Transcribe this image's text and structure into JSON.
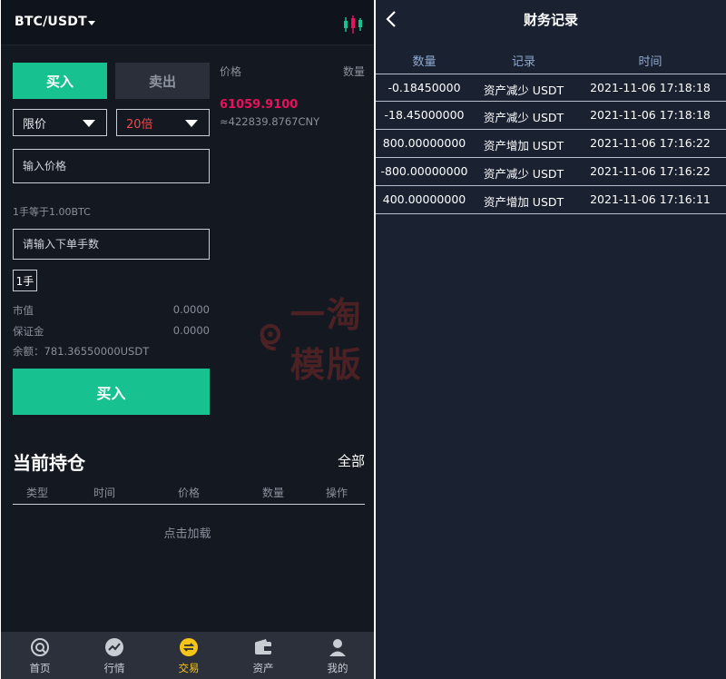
{
  "left": {
    "pair": "BTC/USDT",
    "tabs": {
      "buy": "买入",
      "sell": "卖出"
    },
    "order_type": "限价",
    "leverage": "20倍",
    "price_placeholder": "输入价格",
    "lot_note": "1手等于1.00BTC",
    "lots_placeholder": "请输入下单手数",
    "lot_chip": "1手",
    "stats": {
      "market_value_label": "市值",
      "market_value": "0.0000",
      "margin_label": "保证金",
      "margin": "0.0000",
      "balance": "余额：781.36550000USDT"
    },
    "submit": "买入",
    "orderbook": {
      "price_header": "价格",
      "qty_header": "数量",
      "last_price": "61059.9100",
      "cny_price": "≈422839.8767CNY"
    },
    "positions": {
      "title": "当前持仓",
      "all": "全部",
      "columns": [
        "类型",
        "时间",
        "价格",
        "数量",
        "操作"
      ],
      "empty": "点击加载"
    },
    "watermark": "一淘模版",
    "nav": [
      {
        "label": "首页",
        "icon": "home-icon"
      },
      {
        "label": "行情",
        "icon": "market-icon"
      },
      {
        "label": "交易",
        "icon": "trade-icon"
      },
      {
        "label": "资产",
        "icon": "wallet-icon"
      },
      {
        "label": "我的",
        "icon": "user-icon"
      }
    ],
    "colors": {
      "green": "#18c190",
      "red": "#e8125c",
      "active_nav": "#f5c518"
    }
  },
  "right": {
    "title": "财务记录",
    "headers": [
      "数量",
      "记录",
      "时间"
    ],
    "rows": [
      {
        "amount": "-0.18450000",
        "record": "资产减少 USDT",
        "time": "2021-11-06 17:18:18"
      },
      {
        "amount": "-18.45000000",
        "record": "资产减少 USDT",
        "time": "2021-11-06 17:18:18"
      },
      {
        "amount": "800.00000000",
        "record": "资产增加 USDT",
        "time": "2021-11-06 17:16:22"
      },
      {
        "amount": "-800.00000000",
        "record": "资产减少 USDT",
        "time": "2021-11-06 17:16:22"
      },
      {
        "amount": "400.00000000",
        "record": "资产增加 USDT",
        "time": "2021-11-06 17:16:11"
      }
    ]
  }
}
